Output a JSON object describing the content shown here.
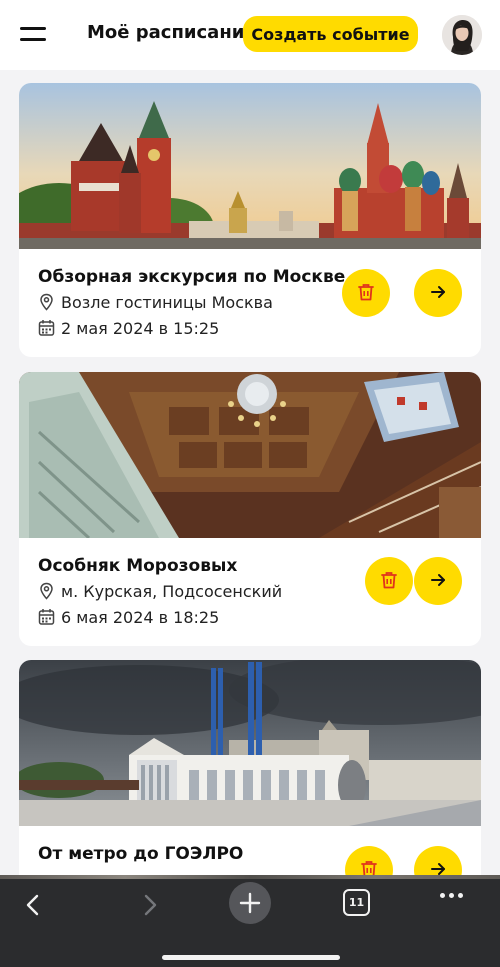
{
  "header": {
    "title": "Моё расписание",
    "create_label": "Создать событие",
    "menu_icon": "hamburger-icon",
    "avatar": "user-avatar"
  },
  "events": [
    {
      "title": "Обзорная экскурсия по Москве",
      "location": "Возле гостиницы Москва",
      "datetime": "2 мая 2024 в 15:25",
      "image": "Kremlin and St. Basil's Cathedral photo"
    },
    {
      "title": "Особняк Морозовых",
      "location": "м. Курская, Подсосенский",
      "datetime": "6 мая 2024 в 18:25",
      "image": "Morozov mansion carved wooden interior photo"
    },
    {
      "title": "От метро до ГОЭЛРО",
      "location": "",
      "datetime": "",
      "image": "GES-2 building with blue chimneys photo"
    }
  ],
  "actions": {
    "delete_icon": "trash-icon",
    "open_icon": "arrow-right-icon",
    "location_icon": "map-pin-icon",
    "date_icon": "calendar-icon"
  },
  "browser_bar": {
    "tabs_count": "11",
    "back_icon": "chevron-left-icon",
    "forward_icon": "chevron-right-icon",
    "new_tab_icon": "plus-icon",
    "more_icon": "ellipsis-icon"
  },
  "colors": {
    "accent": "#ffdb00",
    "text": "#111111",
    "background": "#f3f3f5",
    "bar": "#2b2c2e"
  }
}
